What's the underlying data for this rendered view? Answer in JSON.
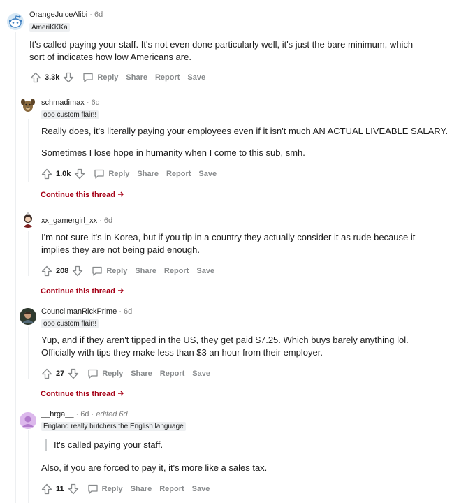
{
  "comments": [
    {
      "author": "OrangeJuiceAlibi",
      "time": "6d",
      "flair": "AmeriKKKa",
      "lines": [
        "It's called paying your staff. It's not even done particularly well, it's just the bare minimum, which",
        "sort of indicates how low Americans are."
      ],
      "score": "3.3k"
    },
    {
      "author": "schmadimax",
      "time": "6d",
      "flair": "ooo custom flair!!",
      "lines": [
        "Really does, it's literally paying your employees even if it isn't much AN ACTUAL LIVEABLE SALARY.",
        "Sometimes I lose hope in humanity when I come to this sub, smh."
      ],
      "score": "1.0k",
      "continue": "Continue this thread"
    },
    {
      "author": "xx_gamergirl_xx",
      "time": "6d",
      "lines": [
        "I'm not sure it's in Korea, but if you tip in a country they actually consider it as rude because it",
        "implies they are not being paid enough."
      ],
      "score": "208",
      "continue": "Continue this thread"
    },
    {
      "author": "CouncilmanRickPrime",
      "time": "6d",
      "flair": "ooo custom flair!!",
      "lines": [
        "Yup, and if they aren't tipped in the US, they get paid $7.25. Which buys barely anything lol.",
        "Officially with tips they make less than $3 an hour from their employer."
      ],
      "score": "27",
      "continue": "Continue this thread"
    },
    {
      "author": "__hrga__",
      "time": "6d",
      "edited": "edited 6d",
      "flair": "England really butchers the English language",
      "quote": "It's called paying your staff.",
      "lines": [
        "Also, if you are forced to pay it, it's more like a sales tax."
      ],
      "score": "11"
    }
  ],
  "actions": {
    "reply": "Reply",
    "share": "Share",
    "report": "Report",
    "save": "Save"
  },
  "separator": "·",
  "icons": {
    "upvote": "upvote-arrow-icon",
    "downvote": "downvote-arrow-icon",
    "reply": "speech-bubble-icon",
    "continue": "arrow-right-icon"
  },
  "colors": {
    "continue_link": "#a50016",
    "action_gray": "#878a8c",
    "flair_bg": "#edeff1"
  }
}
